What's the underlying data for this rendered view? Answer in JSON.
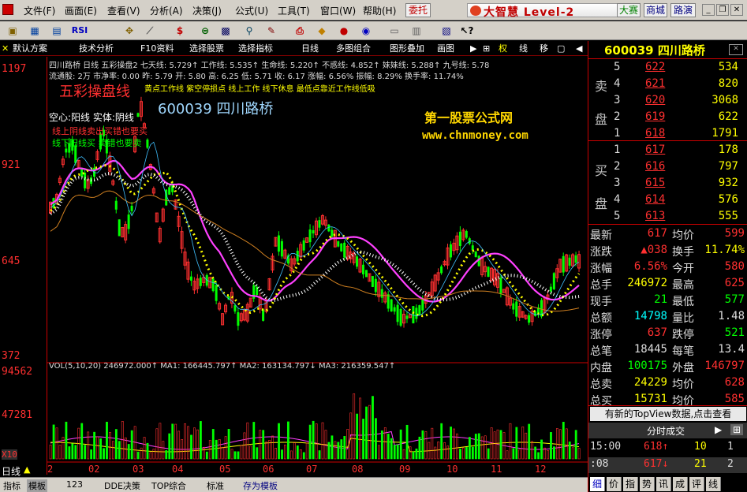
{
  "menu": {
    "items": [
      "文件(F)",
      "画面(E)",
      "查看(V)",
      "分析(A)",
      "决策(J)",
      "公式(U)",
      "工具(T)",
      "窗口(W)",
      "帮助(H)"
    ],
    "entrust": "委托",
    "brand": "大智慧 Level-2",
    "btn_contest": "大赛",
    "btn_mall": "商城",
    "btn_speed": "路演"
  },
  "toolbar": {
    "icons": [
      "open-icon",
      "kline-icon",
      "trend-icon",
      "rsi-icon",
      "crosshair-icon",
      "ruler-icon",
      "dollar-icon",
      "link-icon",
      "binoculars-icon",
      "bookmark-icon",
      "print-icon",
      "diamond-icon",
      "money-icon",
      "help-icon",
      "cursor-help-icon"
    ],
    "rsi_label": "RSI",
    "s_label": "$"
  },
  "tabs": {
    "items": [
      "默认方案",
      "技术分析",
      "F10资料",
      "选择股票",
      "选择指标",
      "日线",
      "多图组合",
      "图形叠加",
      "画图"
    ],
    "right": [
      "权",
      "线",
      "移"
    ]
  },
  "chart": {
    "yaxis": [
      "1197",
      "921",
      "645",
      "372"
    ],
    "vol_yaxis": [
      "94562",
      "47281"
    ],
    "vol_unit": "X10",
    "xaxis": [
      "2",
      "02",
      "03",
      "04",
      "05",
      "06",
      "07",
      "08",
      "09",
      "10",
      "11",
      "12"
    ],
    "line1": "四川路桥 日线 五彩操盘2 七天线: 5.729↑ 工作线: 5.535↑ 生命线: 5.220↑ 不惑线: 4.852↑ 妹妹线: 5.288↑ 九号线: 5.78",
    "line2": "流通股: 2万 市净率: 0.00 昨: 5.79 开: 5.80 高: 6.25 低: 5.71 收: 6.17 涨幅: 6.56% 振幅: 8.29% 换手率: 11.74%",
    "title_big": "五彩操盘线",
    "line3": "黄点工作线 紫空停损点 线上工作 线下休息 最低点靠近工作线低吸",
    "code_name": "600039 四川路桥",
    "legend_hollow": "空心:阳线 实体:阴线",
    "legend_up": "线上阴线卖出买错也要买",
    "legend_down": "线下阳线买 卖错也要卖",
    "watermark1": "第一股票公式网",
    "watermark2": "www.chnmoney.com",
    "vol_line": "VOL(5,10,20) 246972.000↑ MA1: 166445.797↑ MA2: 163134.797↓ MA3: 216359.547↑"
  },
  "bottom": {
    "period": "日线",
    "tabs": [
      "指标",
      "模板",
      "123",
      "DDE决策",
      "TOP综合",
      "标准",
      "存为模板"
    ]
  },
  "quote": {
    "code": "600039",
    "name": "四川路桥",
    "sell_label": [
      "卖",
      "盘"
    ],
    "buy_label": [
      "买",
      "盘"
    ],
    "sells": [
      [
        "5",
        "622",
        "534"
      ],
      [
        "4",
        "621",
        "820"
      ],
      [
        "3",
        "620",
        "3068"
      ],
      [
        "2",
        "619",
        "622"
      ],
      [
        "1",
        "618",
        "1791"
      ]
    ],
    "buys": [
      [
        "1",
        "617",
        "178"
      ],
      [
        "2",
        "616",
        "797"
      ],
      [
        "3",
        "615",
        "932"
      ],
      [
        "4",
        "614",
        "576"
      ],
      [
        "5",
        "613",
        "555"
      ]
    ],
    "stats": [
      [
        "最新",
        "617",
        "均价",
        "599"
      ],
      [
        "涨跌",
        "▲038",
        "换手",
        "11.74%"
      ],
      [
        "涨幅",
        "6.56%",
        "今开",
        "580"
      ],
      [
        "总手",
        "246972",
        "最高",
        "625"
      ],
      [
        "现手",
        "21",
        "最低",
        "577"
      ],
      [
        "总额",
        "14798",
        "量比",
        "1.48"
      ],
      [
        "涨停",
        "637",
        "跌停",
        "521"
      ],
      [
        "总笔",
        "18445",
        "每笔",
        "13.4"
      ],
      [
        "内盘",
        "100175",
        "外盘",
        "146797"
      ],
      [
        "总卖",
        "24229",
        "均价",
        "628"
      ],
      [
        "总买",
        "15731",
        "均价",
        "585"
      ]
    ],
    "topview": "有新的TopView数据,点击查看",
    "ticks_title": "分时成交",
    "ticks": [
      [
        "15:00",
        "618↑",
        "10",
        "1"
      ],
      [
        ":08",
        "617↓",
        "21",
        "2"
      ]
    ],
    "bottom_tabs": [
      "细",
      "价",
      "指",
      "势",
      "讯",
      "成",
      "评",
      "线"
    ]
  },
  "colors": {
    "up": "#ff3030",
    "down": "#00ff00",
    "bg": "#000000",
    "yellow": "#ffff00",
    "cyan": "#00ffff",
    "magenta": "#ff00ff"
  }
}
